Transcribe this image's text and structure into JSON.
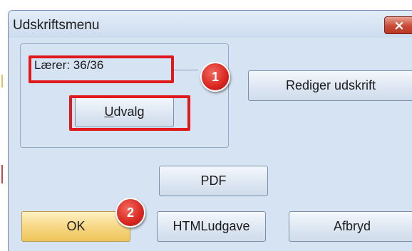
{
  "dialog": {
    "title": "Udskriftsmenu",
    "close_label": "×"
  },
  "group": {
    "legend": "Lærer: 36/36",
    "udvalg_label_mnemonic": "U",
    "udvalg_label_rest": "dvalg"
  },
  "buttons": {
    "rediger": "Rediger udskrift",
    "pdf": "PDF",
    "ok": "OK",
    "html": "HTMLudgave",
    "afbryd": "Afbryd"
  },
  "annotations": {
    "badge_1": "1",
    "badge_2": "2",
    "highlight_color": "#e0191d"
  },
  "colors": {
    "dialog_background": "#d5e3f3",
    "default_button": "#f7d886",
    "close_button": "#c94a36"
  }
}
